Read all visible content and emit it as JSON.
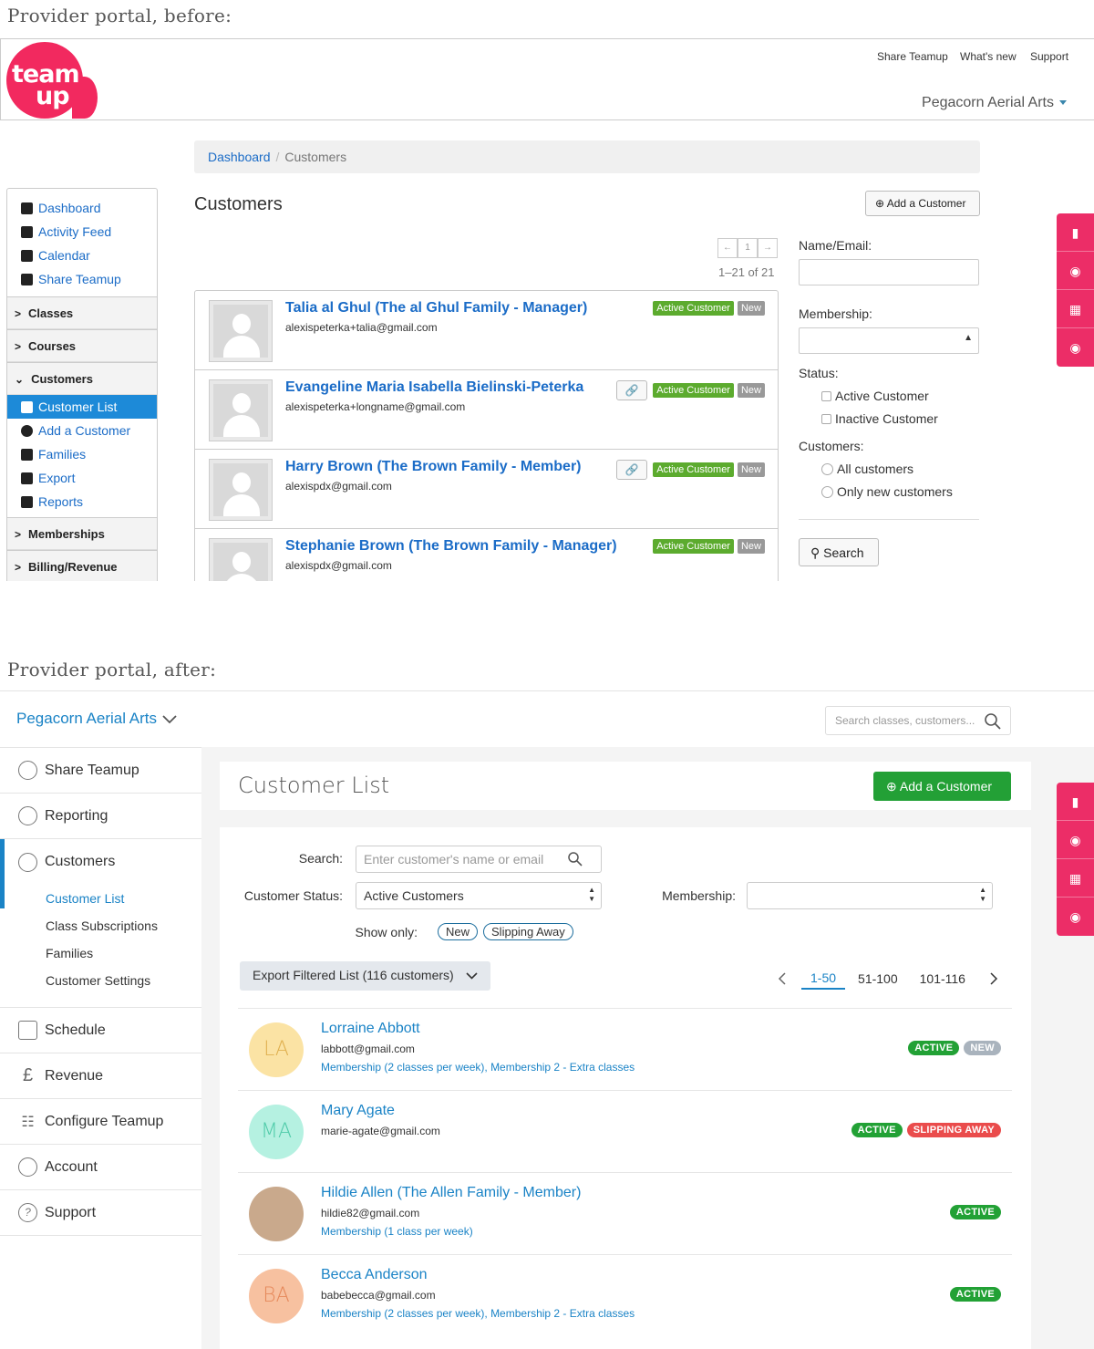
{
  "captions": {
    "before": "Provider portal, before:",
    "after": "Provider portal, after:"
  },
  "before": {
    "logo": {
      "line1": "team",
      "line2": "up"
    },
    "top_links": [
      "Share Teamup",
      "What's new",
      "Support"
    ],
    "org": "Pegacorn Aerial Arts",
    "breadcrumb": {
      "home": "Dashboard",
      "current": "Customers"
    },
    "sidebar": {
      "top_items": [
        "Dashboard",
        "Activity Feed",
        "Calendar",
        "Share Teamup"
      ],
      "sections": [
        "Classes",
        "Courses",
        "Customers"
      ],
      "customer_items": [
        "Customer List",
        "Add a Customer",
        "Families",
        "Export",
        "Reports"
      ],
      "bottom_sections": [
        "Memberships",
        "Billing/Revenue"
      ]
    },
    "title": "Customers",
    "add_button": "Add a Customer",
    "pagination": {
      "prev": "←",
      "page": "1",
      "next": "→",
      "count": "1–21 of 21"
    },
    "customers": [
      {
        "name": "Talia al Ghul (The al Ghul Family - Manager)",
        "email": "alexispeterka+talia@gmail.com",
        "link": false
      },
      {
        "name": "Evangeline Maria Isabella Bielinski-Peterka",
        "email": "alexispeterka+longname@gmail.com",
        "link": true
      },
      {
        "name": "Harry Brown (The Brown Family - Member)",
        "email": "alexispdx@gmail.com",
        "link": true
      },
      {
        "name": "Stephanie Brown (The Brown Family - Manager)",
        "email": "alexispdx@gmail.com",
        "link": false
      }
    ],
    "tag_active": "Active Customer",
    "tag_new": "New",
    "filters": {
      "name_label": "Name/Email:",
      "membership_label": "Membership:",
      "status_label": "Status:",
      "status_options": [
        "Active Customer",
        "Inactive Customer"
      ],
      "customers_label": "Customers:",
      "customers_options": [
        "All customers",
        "Only new customers"
      ],
      "search_button": "Search"
    }
  },
  "after": {
    "org": "Pegacorn Aerial Arts",
    "global_search_placeholder": "Search classes, customers...",
    "sidebar": {
      "items_top": [
        "Share Teamup",
        "Reporting",
        "Customers"
      ],
      "customer_sub": [
        "Customer List",
        "Class Subscriptions",
        "Families",
        "Customer Settings"
      ],
      "items_bottom": [
        "Schedule",
        "Revenue",
        "Configure Teamup",
        "Account",
        "Support"
      ]
    },
    "title": "Customer List",
    "add_button": "Add a Customer",
    "filters": {
      "search_label": "Search:",
      "search_placeholder": "Enter customer's name or email",
      "status_label": "Customer Status:",
      "status_value": "Active Customers",
      "membership_label": "Membership:",
      "membership_value": "",
      "show_only_label": "Show only:",
      "show_only": [
        "New",
        "Slipping Away"
      ]
    },
    "export_button": "Export Filtered List (116 customers)",
    "pages": [
      "1-50",
      "51-100",
      "101-116"
    ],
    "customers": [
      {
        "initials": "LA",
        "name": "Lorraine Abbott",
        "email": "labbott@gmail.com",
        "membership": "Membership (2 classes per week), Membership 2 - Extra classes",
        "tags": [
          "ACTIVE",
          "NEW"
        ],
        "avatar_color": "#fbe3a4"
      },
      {
        "initials": "MA",
        "name": "Mary Agate",
        "email": "marie-agate@gmail.com",
        "membership": "",
        "tags": [
          "ACTIVE",
          "SLIPPING AWAY"
        ],
        "avatar_color": "#b5f1e1"
      },
      {
        "initials": "",
        "name": "Hildie Allen (The Allen Family - Member)",
        "email": "hildie82@gmail.com",
        "membership": "Membership (1 class per week)",
        "tags": [
          "ACTIVE"
        ],
        "avatar_color": "#c9a98c"
      },
      {
        "initials": "BA",
        "name": "Becca Anderson",
        "email": "babebecca@gmail.com",
        "membership": "Membership (2 classes per week), Membership 2 - Extra classes",
        "tags": [
          "ACTIVE"
        ],
        "avatar_color": "#f7c1a0"
      }
    ],
    "tag_colors": {
      "ACTIVE": "#22a135",
      "NEW": "#a9b3bd",
      "SLIPPING AWAY": "#ea4c4c"
    }
  }
}
